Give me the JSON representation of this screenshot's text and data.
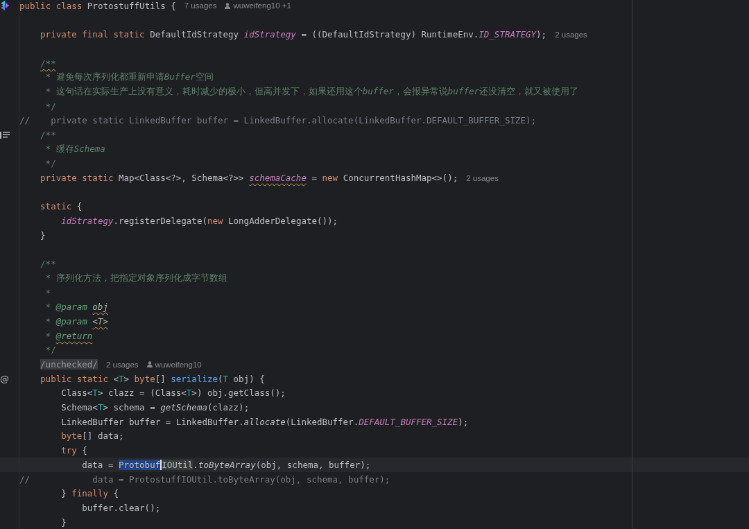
{
  "editor": {
    "lines": [
      {
        "kind": "code",
        "gutter": {
          "kind": "logo"
        },
        "tokens": [
          {
            "text": "public class ",
            "kind": "keyword"
          },
          {
            "text": "ProtostuffUtils {",
            "kind": "plain"
          }
        ],
        "hints": [
          {
            "kind": "usages",
            "text": "7 usages"
          },
          {
            "kind": "author",
            "text": "wuweifeng10 +1"
          }
        ],
        "children": [
          {
            "kind": "blank"
          },
          {
            "kind": "code",
            "tokens": [
              {
                "text": "private final static ",
                "kind": "keyword"
              },
              {
                "text": "DefaultIdStrategy ",
                "kind": "plain"
              },
              {
                "text": "idStrategy",
                "kind": "field"
              },
              {
                "text": " = ((DefaultIdStrategy) RuntimeEnv.",
                "kind": "plain"
              },
              {
                "text": "ID_STRATEGY",
                "kind": "field"
              },
              {
                "text": ");",
                "kind": "plain"
              }
            ],
            "hints": [
              {
                "kind": "usages",
                "text": "2 usages"
              }
            ]
          },
          {
            "kind": "blank"
          },
          {
            "kind": "code",
            "tokens": [
              {
                "text": "/**",
                "kind": "doc",
                "squiggle": true
              }
            ]
          },
          {
            "kind": "code",
            "tokens": [
              {
                "text": " * 避免每次序列化都重新申请",
                "kind": "doc"
              },
              {
                "text": "Buffer",
                "kind": "docitalic"
              },
              {
                "text": "空间",
                "kind": "doc"
              }
            ]
          },
          {
            "kind": "code",
            "tokens": [
              {
                "text": " * 这句话在实际生产上没有意义，耗时减少的极小，但高并发下，如果还用这个",
                "kind": "doc"
              },
              {
                "text": "buffer",
                "kind": "docitalic"
              },
              {
                "text": "，会报异常说",
                "kind": "doc"
              },
              {
                "text": "buffer",
                "kind": "docitalic"
              },
              {
                "text": "还没清空，就又被使用了",
                "kind": "doc"
              }
            ]
          },
          {
            "kind": "code",
            "tokens": [
              {
                "text": " */",
                "kind": "doc"
              }
            ]
          },
          {
            "kind": "commented",
            "tokens": [
              {
                "text": "//    private static LinkedBuffer buffer = LinkedBuffer.allocate(LinkedBuffer.DEFAULT_BUFFER_SIZE);",
                "kind": "comment"
              }
            ]
          },
          {
            "kind": "code",
            "gutter": {
              "kind": "list"
            },
            "tokens": [
              {
                "text": "/**",
                "kind": "doc"
              }
            ]
          },
          {
            "kind": "code",
            "tokens": [
              {
                "text": " * 缓存",
                "kind": "doc"
              },
              {
                "text": "Schema",
                "kind": "docitalic"
              }
            ]
          },
          {
            "kind": "code",
            "tokens": [
              {
                "text": " */",
                "kind": "doc"
              }
            ]
          },
          {
            "kind": "code",
            "tokens": [
              {
                "text": "private static ",
                "kind": "keyword"
              },
              {
                "text": "Map<Class<?>, Schema<?>> ",
                "kind": "plain"
              },
              {
                "text": "schemaCache",
                "kind": "field",
                "squiggle": true
              },
              {
                "text": " = ",
                "kind": "plain"
              },
              {
                "text": "new ",
                "kind": "keyword"
              },
              {
                "text": "ConcurrentHashMap<>();",
                "kind": "plain"
              }
            ],
            "hints": [
              {
                "kind": "usages",
                "text": "2 usages"
              }
            ]
          },
          {
            "kind": "blank"
          },
          {
            "kind": "code",
            "tokens": [
              {
                "text": "static ",
                "kind": "keyword"
              },
              {
                "text": "{",
                "kind": "plain"
              }
            ],
            "children": [
              {
                "kind": "code",
                "tokens": [
                  {
                    "text": "idStrategy",
                    "kind": "field"
                  },
                  {
                    "text": ".registerDelegate(",
                    "kind": "plain"
                  },
                  {
                    "text": "new ",
                    "kind": "keyword"
                  },
                  {
                    "text": "LongAdderDelegate());",
                    "kind": "plain"
                  }
                ]
              }
            ]
          },
          {
            "kind": "code",
            "tokens": [
              {
                "text": "}",
                "kind": "plain"
              }
            ]
          },
          {
            "kind": "blank"
          },
          {
            "kind": "code",
            "tokens": [
              {
                "text": "/**",
                "kind": "doc"
              }
            ]
          },
          {
            "kind": "code",
            "tokens": [
              {
                "text": " * 序列化方法，把指定对象序列化成字节数组",
                "kind": "doc"
              }
            ]
          },
          {
            "kind": "code",
            "tokens": [
              {
                "text": " *",
                "kind": "doc"
              }
            ]
          },
          {
            "kind": "code",
            "tokens": [
              {
                "text": " * ",
                "kind": "doc"
              },
              {
                "text": "@param",
                "kind": "doctag"
              },
              {
                "text": "obj",
                "kind": "docref",
                "squiggle": true
              }
            ]
          },
          {
            "kind": "code",
            "tokens": [
              {
                "text": " * ",
                "kind": "doc"
              },
              {
                "text": "@param",
                "kind": "doctag"
              },
              {
                "text": "<T>",
                "kind": "docref",
                "squiggle": true
              }
            ]
          },
          {
            "kind": "code",
            "tokens": [
              {
                "text": " * ",
                "kind": "doc"
              },
              {
                "text": "@return",
                "kind": "doctag",
                "squiggle": true
              }
            ]
          },
          {
            "kind": "code",
            "tokens": [
              {
                "text": " */",
                "kind": "doc"
              }
            ]
          },
          {
            "kind": "code",
            "tokens": [
              {
                "text": "/unchecked/",
                "kind": "annotation"
              }
            ],
            "hints": [
              {
                "kind": "usages",
                "text": "2 usages"
              },
              {
                "kind": "author",
                "text": "wuweifeng10"
              }
            ]
          },
          {
            "kind": "code",
            "gutter": {
              "kind": "mark",
              "text": "@"
            },
            "tokens": [
              {
                "text": "public static ",
                "kind": "keyword"
              },
              {
                "text": "<",
                "kind": "plain"
              },
              {
                "text": "T",
                "kind": "typeparam"
              },
              {
                "text": "> ",
                "kind": "plain"
              },
              {
                "text": "byte",
                "kind": "keyword"
              },
              {
                "text": "[] ",
                "kind": "plain"
              },
              {
                "text": "serialize",
                "kind": "method"
              },
              {
                "text": "(",
                "kind": "plain"
              },
              {
                "text": "T",
                "kind": "typeparam"
              },
              {
                "text": " obj) {",
                "kind": "plain"
              }
            ],
            "children": [
              {
                "kind": "code",
                "tokens": [
                  {
                    "text": "Class<",
                    "kind": "plain"
                  },
                  {
                    "text": "T",
                    "kind": "typeparam"
                  },
                  {
                    "text": "> clazz = (Class<",
                    "kind": "plain"
                  },
                  {
                    "text": "T",
                    "kind": "typeparam"
                  },
                  {
                    "text": ">) obj.getClass();",
                    "kind": "plain"
                  }
                ]
              },
              {
                "kind": "code",
                "tokens": [
                  {
                    "text": "Schema<",
                    "kind": "plain"
                  },
                  {
                    "text": "T",
                    "kind": "typeparam"
                  },
                  {
                    "text": "> schema = ",
                    "kind": "plain"
                  },
                  {
                    "text": "getSchema",
                    "kind": "call"
                  },
                  {
                    "text": "(clazz);",
                    "kind": "plain"
                  }
                ]
              },
              {
                "kind": "code",
                "tokens": [
                  {
                    "text": "LinkedBuffer buffer = LinkedBuffer.",
                    "kind": "plain"
                  },
                  {
                    "text": "allocate",
                    "kind": "call"
                  },
                  {
                    "text": "(LinkedBuffer.",
                    "kind": "plain"
                  },
                  {
                    "text": "DEFAULT_BUFFER_SIZE",
                    "kind": "field"
                  },
                  {
                    "text": ");",
                    "kind": "plain"
                  }
                ]
              },
              {
                "kind": "code",
                "tokens": [
                  {
                    "text": "byte",
                    "kind": "keyword"
                  },
                  {
                    "text": "[] data;",
                    "kind": "plain"
                  }
                ]
              },
              {
                "kind": "code",
                "tokens": [
                  {
                    "text": "try ",
                    "kind": "keyword"
                  },
                  {
                    "text": "{",
                    "kind": "plain"
                  }
                ],
                "children": [
                  {
                    "kind": "code",
                    "current": true,
                    "tokens": [
                      {
                        "text": "data = ",
                        "kind": "plain"
                      },
                      {
                        "text": "Protobuf",
                        "kind": "selection"
                      },
                      {
                        "text": "IOUtil",
                        "kind": "occurrence"
                      },
                      {
                        "text": ".",
                        "kind": "plain"
                      },
                      {
                        "text": "toByteArray",
                        "kind": "call"
                      },
                      {
                        "text": "(obj, schema, buffer);",
                        "kind": "plain"
                      }
                    ]
                  },
                  {
                    "kind": "commented",
                    "tokens": [
                      {
                        "text": "//            data = ProtostuffIOUtil.toByteArray(obj, schema, buffer);",
                        "kind": "comment"
                      }
                    ]
                  }
                ]
              },
              {
                "kind": "code",
                "tokens": [
                  {
                    "text": "} ",
                    "kind": "plain"
                  },
                  {
                    "text": "finally ",
                    "kind": "keyword"
                  },
                  {
                    "text": "{",
                    "kind": "plain"
                  }
                ],
                "children": [
                  {
                    "kind": "code",
                    "tokens": [
                      {
                        "text": "buffer.clear();",
                        "kind": "plain"
                      }
                    ]
                  }
                ]
              },
              {
                "kind": "code",
                "tokens": [
                  {
                    "text": "}",
                    "kind": "plain"
                  }
                ]
              }
            ]
          }
        ]
      }
    ]
  }
}
